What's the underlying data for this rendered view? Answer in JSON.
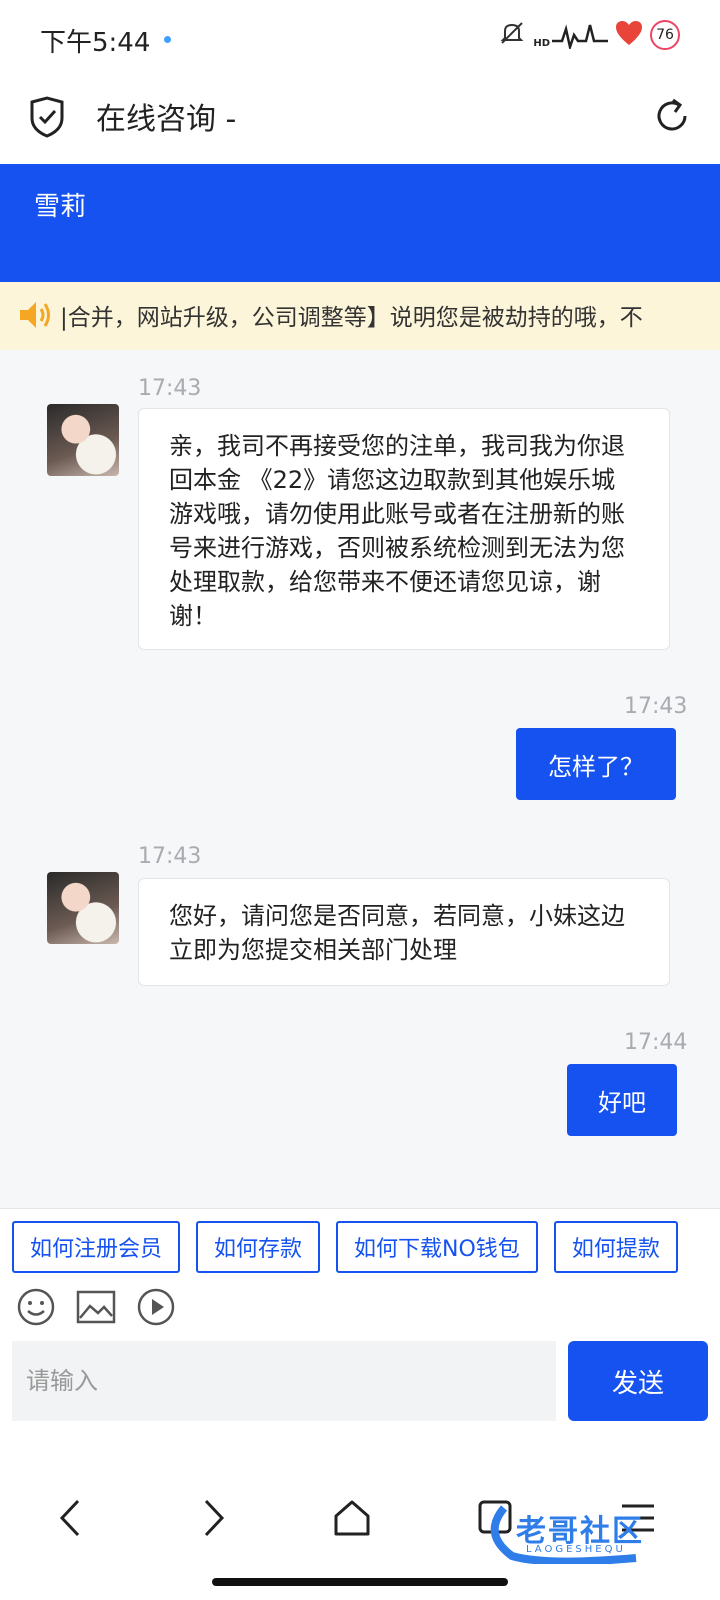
{
  "status_bar": {
    "time": "下午5:44",
    "hd": "HD",
    "battery": "76"
  },
  "title_bar": {
    "title": "在线咨询 -"
  },
  "header": {
    "agent_name": "雪莉"
  },
  "notice": {
    "text": "|合并，网站升级，公司调整等】说明您是被劫持的哦，不"
  },
  "messages": [
    {
      "side": "left",
      "time": "17:43",
      "text": "亲，我司不再接受您的注单，我司我为你退回本金 《22》请您这边取款到其他娱乐城游戏哦，请勿使用此账号或者在注册新的账号来进行游戏，否则被系统检测到无法为您处理取款，给您带来不便还请您见谅，谢谢！"
    },
    {
      "side": "right",
      "time": "17:43",
      "text": "怎样了？"
    },
    {
      "side": "left",
      "time": "17:43",
      "text": "您好，请问您是否同意，若同意，小妹这边立即为您提交相关部门处理"
    },
    {
      "side": "right",
      "time": "17:44",
      "text": "好吧"
    }
  ],
  "quick_replies": [
    "如何注册会员",
    "如何存款",
    "如何下载NO钱包",
    "如何提款"
  ],
  "input": {
    "placeholder": "请输入",
    "send_label": "发送"
  },
  "watermark": {
    "title": "老哥社区",
    "subtitle": "LAOGESHEQU"
  },
  "colors": {
    "brand_blue": "#1552f0",
    "notice_bg": "#fdf5d9"
  }
}
